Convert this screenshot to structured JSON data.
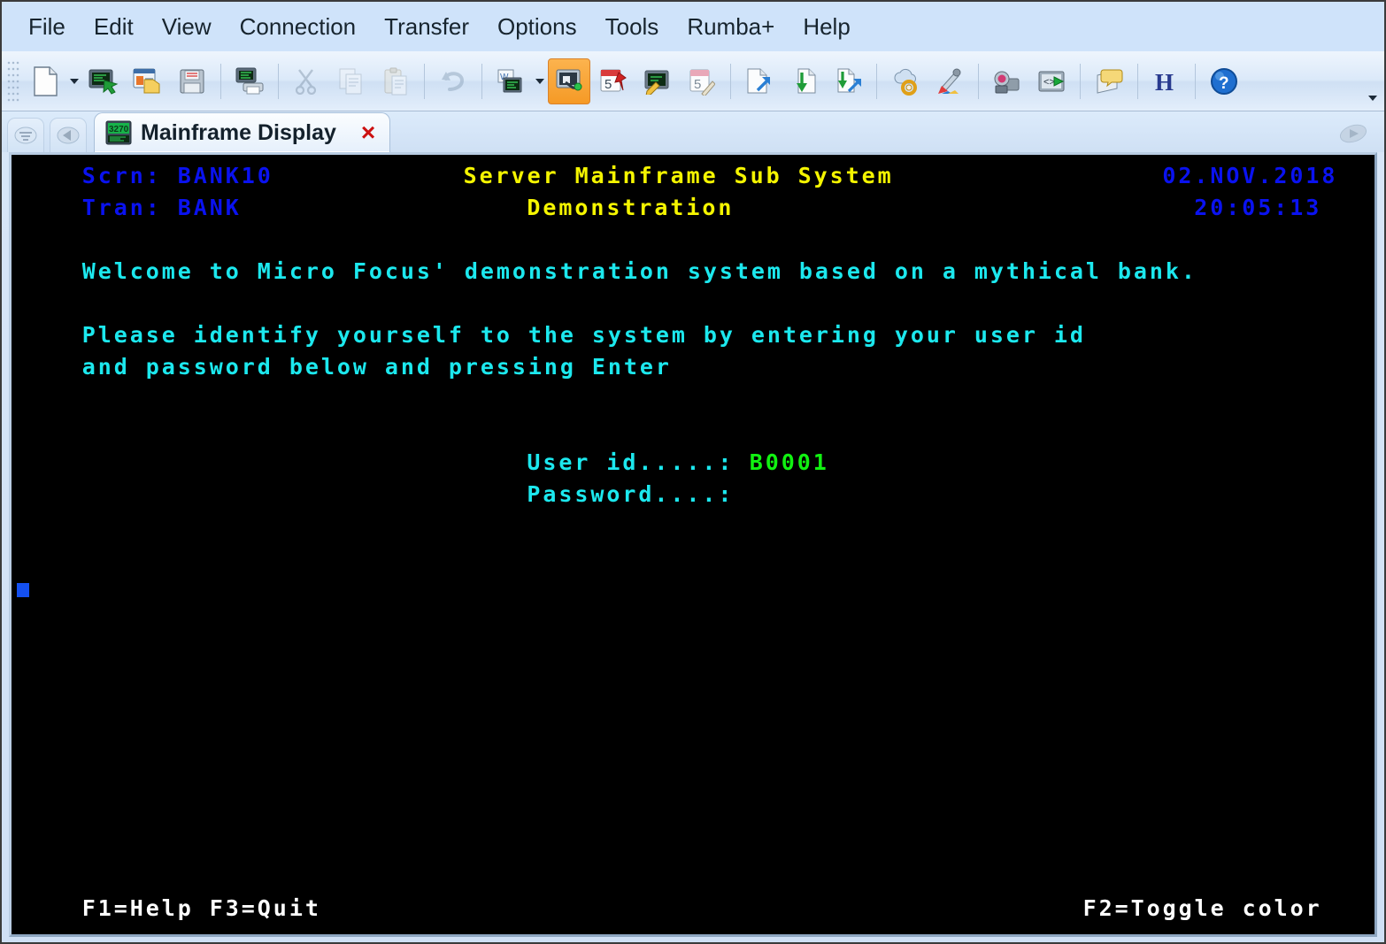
{
  "window": {
    "title": "Mainframe Display"
  },
  "menubar": {
    "items": [
      {
        "label": "File",
        "name": "menu-file"
      },
      {
        "label": "Edit",
        "name": "menu-edit"
      },
      {
        "label": "View",
        "name": "menu-view"
      },
      {
        "label": "Connection",
        "name": "menu-connection"
      },
      {
        "label": "Transfer",
        "name": "menu-transfer"
      },
      {
        "label": "Options",
        "name": "menu-options"
      },
      {
        "label": "Tools",
        "name": "menu-tools"
      },
      {
        "label": "Rumba+",
        "name": "menu-rumba-plus"
      },
      {
        "label": "Help",
        "name": "menu-help"
      }
    ]
  },
  "toolbar": {
    "buttons": [
      {
        "icon": "new-document-icon",
        "tooltip": "New",
        "state": "normal"
      },
      {
        "icon": "new-session-icon",
        "tooltip": "New Session",
        "state": "normal"
      },
      {
        "icon": "open-folder-icon",
        "tooltip": "Open",
        "state": "normal"
      },
      {
        "icon": "save-floppy-icon",
        "tooltip": "Save",
        "state": "normal"
      },
      {
        "icon": "print-screen-icon",
        "tooltip": "Print",
        "state": "normal"
      },
      {
        "icon": "cut-scissors-icon",
        "tooltip": "Cut",
        "state": "disabled"
      },
      {
        "icon": "copy-icon",
        "tooltip": "Copy",
        "state": "disabled"
      },
      {
        "icon": "paste-icon",
        "tooltip": "Paste",
        "state": "disabled"
      },
      {
        "icon": "undo-arrow-icon",
        "tooltip": "Undo",
        "state": "disabled"
      },
      {
        "icon": "copy-to-office-icon",
        "tooltip": "Copy to Office",
        "state": "normal"
      },
      {
        "icon": "connect-session-icon",
        "tooltip": "Connect",
        "state": "active"
      },
      {
        "icon": "calendar-pin-icon",
        "tooltip": "Schedule",
        "state": "normal"
      },
      {
        "icon": "edit-screen-icon",
        "tooltip": "Edit Screen",
        "state": "normal"
      },
      {
        "icon": "calendar-pencil-icon",
        "tooltip": "Calendar",
        "state": "normal"
      },
      {
        "icon": "send-file-icon",
        "tooltip": "Send File",
        "state": "normal"
      },
      {
        "icon": "receive-file-icon",
        "tooltip": "Receive File",
        "state": "normal"
      },
      {
        "icon": "transfer-both-icon",
        "tooltip": "Transfer",
        "state": "normal"
      },
      {
        "icon": "settings-gear-icon",
        "tooltip": "Settings",
        "state": "normal"
      },
      {
        "icon": "color-palette-icon",
        "tooltip": "Colors",
        "state": "normal"
      },
      {
        "icon": "record-macro-icon",
        "tooltip": "Record Macro",
        "state": "normal"
      },
      {
        "icon": "run-macro-icon",
        "tooltip": "Run Macro",
        "state": "normal"
      },
      {
        "icon": "hotspot-note-icon",
        "tooltip": "Hotspots",
        "state": "normal"
      },
      {
        "icon": "hllapi-icon",
        "tooltip": "HLLAPI",
        "state": "normal"
      },
      {
        "icon": "help-question-icon",
        "tooltip": "Help",
        "state": "normal"
      }
    ]
  },
  "tabs": {
    "active": "Mainframe Display",
    "close_label": "×",
    "icon": "terminal-3270-icon"
  },
  "terminal": {
    "colors": {
      "background": "#000000",
      "blue": "#0a12f0",
      "yellow": "#f5f500",
      "cyan": "#1ce8ee",
      "green": "#11f211",
      "white": "#ffffff",
      "cursor": "#1450f0"
    },
    "lines": [
      {
        "row": 0,
        "cells": [
          {
            "col": 4,
            "text": "Scrn: BANK10",
            "color": "blue"
          },
          {
            "col": 28,
            "text": "Server Mainframe Sub System",
            "color": "yellow"
          },
          {
            "col": 72,
            "text": "02.NOV.2018",
            "color": "blue"
          }
        ]
      },
      {
        "row": 1,
        "cells": [
          {
            "col": 4,
            "text": "Tran: BANK",
            "color": "blue"
          },
          {
            "col": 32,
            "text": "Demonstration",
            "color": "yellow"
          },
          {
            "col": 74,
            "text": "20:05:13",
            "color": "blue"
          }
        ]
      },
      {
        "row": 3,
        "cells": [
          {
            "col": 4,
            "text": "Welcome to Micro Focus' demonstration system based on a mythical bank.",
            "color": "cyan"
          }
        ]
      },
      {
        "row": 5,
        "cells": [
          {
            "col": 4,
            "text": "Please identify yourself to the system by entering your user id",
            "color": "cyan"
          }
        ]
      },
      {
        "row": 6,
        "cells": [
          {
            "col": 4,
            "text": "and password below and pressing Enter",
            "color": "cyan"
          }
        ]
      },
      {
        "row": 9,
        "cells": [
          {
            "col": 32,
            "text": "User id.....:",
            "color": "cyan"
          },
          {
            "col": 46,
            "text": "B0001",
            "color": "green"
          }
        ]
      },
      {
        "row": 10,
        "cells": [
          {
            "col": 32,
            "text": "Password....:",
            "color": "cyan"
          }
        ]
      },
      {
        "row": 23,
        "cells": [
          {
            "col": 4,
            "text": "F1=Help F3=Quit",
            "color": "white"
          },
          {
            "col": 67,
            "text": "F2=Toggle color",
            "color": "white"
          }
        ]
      }
    ],
    "cursor": {
      "row": 13,
      "col": 0
    }
  }
}
